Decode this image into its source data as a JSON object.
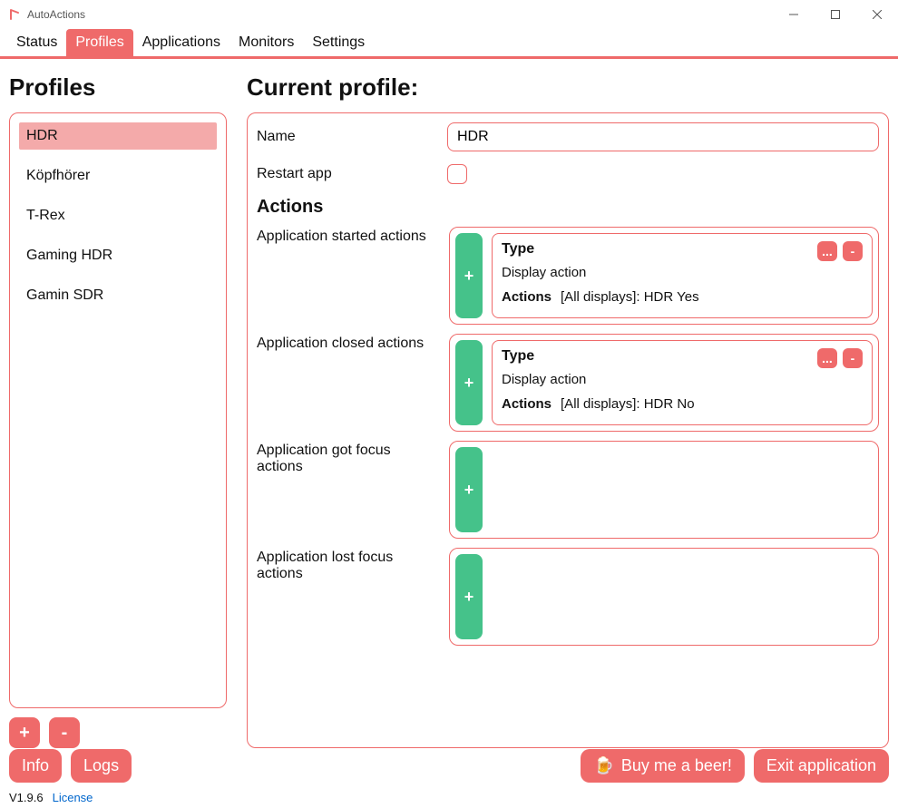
{
  "window": {
    "title": "AutoActions"
  },
  "menu": {
    "tabs": [
      "Status",
      "Profiles",
      "Applications",
      "Monitors",
      "Settings"
    ],
    "active_index": 1
  },
  "left": {
    "heading": "Profiles",
    "profiles": [
      "HDR",
      "Köpfhörer",
      "T-Rex",
      "Gaming HDR",
      "Gamin SDR"
    ],
    "selected_index": 0,
    "add_label": "+",
    "remove_label": "-"
  },
  "right": {
    "heading": "Current profile:",
    "name_label": "Name",
    "name_value": "HDR",
    "restart_label": "Restart app",
    "restart_checked": false,
    "actions_heading": "Actions",
    "sections": [
      {
        "label": "Application started actions",
        "card": {
          "type_label": "Type",
          "type_value": "Display action",
          "actions_label": "Actions",
          "actions_value": "[All displays]: HDR Yes"
        }
      },
      {
        "label": "Application closed actions",
        "card": {
          "type_label": "Type",
          "type_value": "Display action",
          "actions_label": "Actions",
          "actions_value": "[All displays]: HDR No"
        }
      },
      {
        "label": "Application got focus actions",
        "card": null
      },
      {
        "label": "Application lost focus actions",
        "card": null
      }
    ],
    "add_label": "+",
    "edit_label": "...",
    "remove_label": "-"
  },
  "footer": {
    "info": "Info",
    "logs": "Logs",
    "beer": "Buy me a beer!",
    "exit": "Exit application",
    "version": "V1.9.6",
    "license": "License"
  }
}
